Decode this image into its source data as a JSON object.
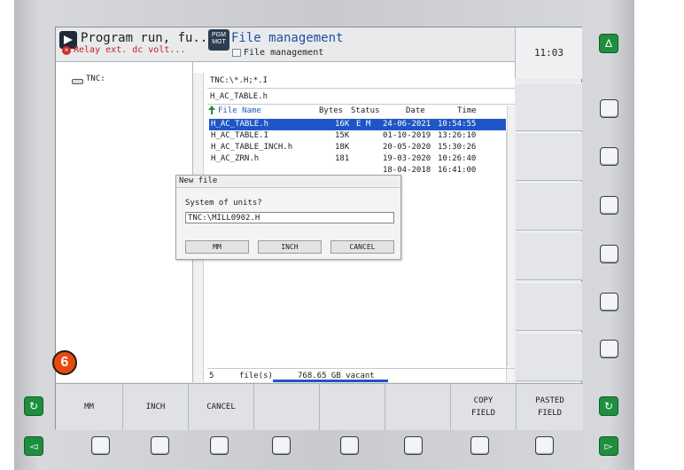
{
  "header": {
    "mode_title": "Program run, fu...",
    "mode_error": "Relay ext. dc volt...",
    "pgm_badge_top": "PGM",
    "pgm_badge_bottom": "MGT",
    "pgm_title": "File management",
    "pgm_subtitle": "File management",
    "clock": "11:03"
  },
  "left_pane": {
    "drive_label": "TNC:"
  },
  "file_pane": {
    "path": "TNC:\\*.H;*.I",
    "current_file": "H_AC_TABLE.h",
    "columns": {
      "name": "File Name",
      "bytes": "Bytes",
      "status": "Status",
      "date": "Date",
      "time": "Time"
    },
    "rows": [
      {
        "name": "H_AC_TABLE.h",
        "bytes": "16K",
        "status": "E M",
        "date": "24-06-2021",
        "time": "10:54:55"
      },
      {
        "name": "H_AC_TABLE.I",
        "bytes": "15K",
        "status": "",
        "date": "01-10-2019",
        "time": "13:26:10"
      },
      {
        "name": "H_AC_TABLE_INCH.h",
        "bytes": "18K",
        "status": "",
        "date": "20-05-2020",
        "time": "15:30:26"
      },
      {
        "name": "H_AC_ZRN.h",
        "bytes": "181",
        "status": "",
        "date": "19-03-2020",
        "time": "10:26:40"
      },
      {
        "name": "",
        "bytes": "",
        "status": "",
        "date": "18-04-2018",
        "time": "16:41:00"
      }
    ],
    "footer": {
      "count": "5",
      "files_label": "file(s)",
      "vacant": "768.65 GB vacant"
    }
  },
  "dialog": {
    "title": "New file",
    "prompt": "System of units?",
    "input_value": "TNC:\\MILL0902.H",
    "buttons": [
      "MM",
      "INCH",
      "CANCEL"
    ]
  },
  "softkeys": {
    "mm": "MM",
    "inch": "INCH",
    "cancel": "CANCEL",
    "copy_field_1": "COPY",
    "copy_field_2": "FIELD",
    "pasted_field_1": "PASTED",
    "pasted_field_2": "FIELD"
  },
  "badge": "6",
  "icons": {
    "up_right": "triangle-up-icon",
    "left_cycle": "cycle-icon",
    "right_cycle": "cycle-icon",
    "bottom_left": "triangle-left-icon",
    "bottom_right": "triangle-right-icon"
  },
  "colors": {
    "accent_green": "#1f8f3f",
    "selection_blue": "#1f56c6",
    "badge_orange": "#e64a0e"
  }
}
